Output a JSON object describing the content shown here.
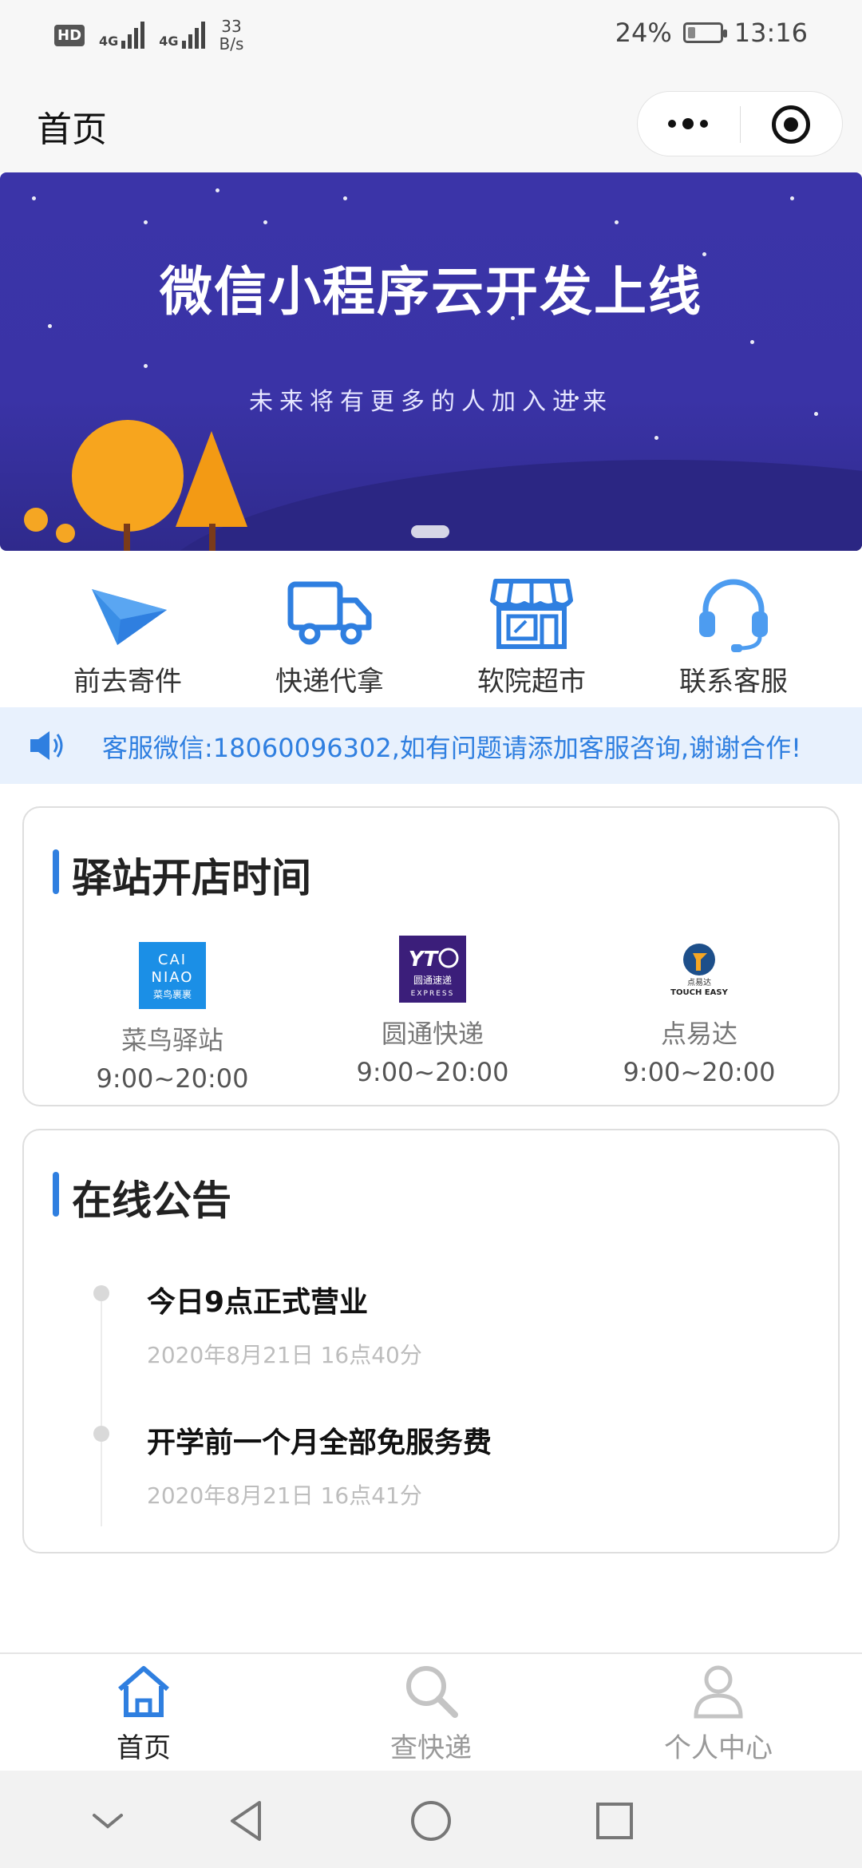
{
  "status_bar": {
    "hd": "HD",
    "net1": "4G",
    "net2": "4G",
    "speed_value": "33",
    "speed_unit": "B/s",
    "battery": "24%",
    "battery_level": 0.24,
    "time": "13:16"
  },
  "nav": {
    "title": "首页",
    "more_icon": "more-dots-icon",
    "close_icon": "target-circle-icon"
  },
  "banner": {
    "title": "微信小程序云开发上线",
    "subtitle": "未来将有更多的人加入进来",
    "bg_color": "#3b34a8"
  },
  "quick_menu": [
    {
      "label": "前去寄件",
      "icon": "paper-plane-icon"
    },
    {
      "label": "快递代拿",
      "icon": "truck-icon"
    },
    {
      "label": "软院超市",
      "icon": "store-icon"
    },
    {
      "label": "联系客服",
      "icon": "headset-icon"
    }
  ],
  "notice": {
    "icon": "speaker-icon",
    "text": "客服微信:18060096302,如有问题请添加客服咨询,谢谢合作!",
    "color": "#2f7fe0"
  },
  "stations": {
    "title": "驿站开店时间",
    "items": [
      {
        "name": "菜鸟驿站",
        "hours": "9:00~20:00",
        "logo": "cainiao-logo",
        "logo_text": "CAI NIAO 菜鸟裹裹"
      },
      {
        "name": "圆通快递",
        "hours": "9:00~20:00",
        "logo": "yto-logo",
        "logo_text": "YTO 圆通速递 EXPRESS"
      },
      {
        "name": "点易达",
        "hours": "9:00~20:00",
        "logo": "touch-easy-logo",
        "logo_text": "点易达 TOUCH EASY"
      }
    ]
  },
  "announcements": {
    "title": "在线公告",
    "items": [
      {
        "title": "今日9点正式营业",
        "date": "2020年8月21日 16点40分"
      },
      {
        "title": "开学前一个月全部免服务费",
        "date": "2020年8月21日 16点41分"
      }
    ]
  },
  "tabbar": {
    "active_color": "#2f7fe0",
    "inactive_color": "#999999",
    "items": [
      {
        "label": "首页",
        "icon": "home-icon",
        "active": true
      },
      {
        "label": "查快递",
        "icon": "search-icon",
        "active": false
      },
      {
        "label": "个人中心",
        "icon": "user-icon",
        "active": false
      }
    ]
  },
  "system_nav": {
    "items": [
      "chevron-down-icon",
      "back-triangle-icon",
      "home-circle-icon",
      "recent-square-icon"
    ]
  }
}
